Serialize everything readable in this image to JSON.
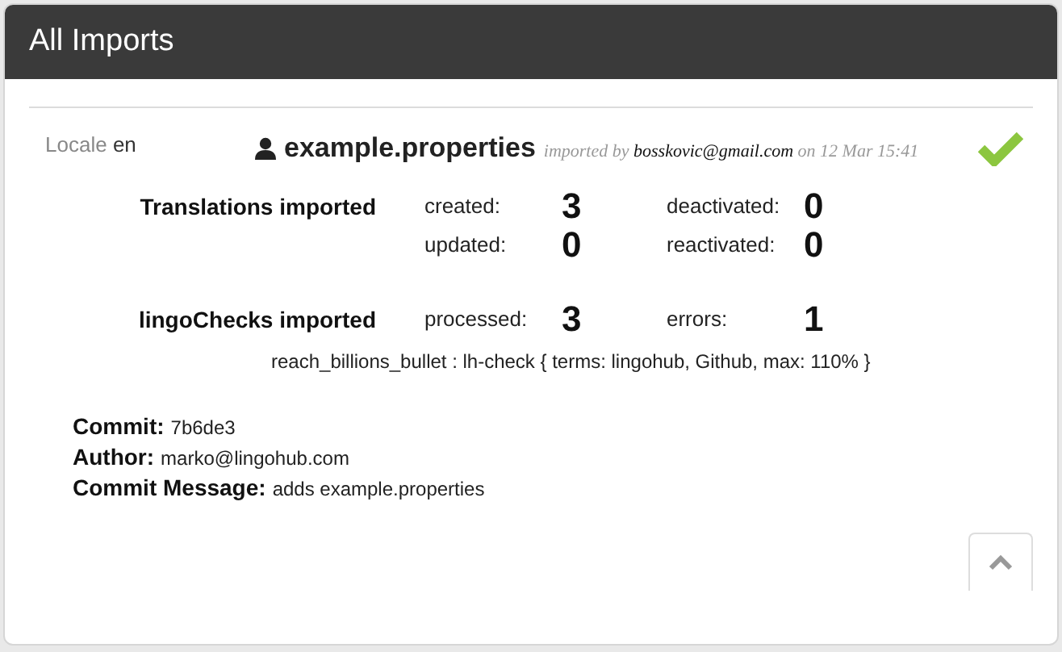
{
  "header": {
    "title": "All Imports"
  },
  "import": {
    "locale_label": "Locale",
    "locale": "en",
    "file": "example.properties",
    "imported_by": "imported by **bosskovic@gmail.com** on 12 Mar 15:41",
    "success": true,
    "sections": [
      {
        "title": "Translations imported",
        "stats": [
          {
            "label": "created:",
            "value": "3"
          },
          {
            "label": "deactivated:",
            "value": "0"
          },
          {
            "label": "updated:",
            "value": "0"
          },
          {
            "label": "reactivated:",
            "value": "0"
          }
        ]
      },
      {
        "title": "lingoChecks imported",
        "stats": [
          {
            "label": "processed:",
            "value": "3"
          },
          {
            "label": "errors:",
            "value": "1"
          }
        ],
        "errors": [
          "reach_billions_bullet : lh-check { terms: lingohub, Github, max: 110% }"
        ]
      }
    ],
    "commit": [
      {
        "label": "Commit:",
        "value": "7b6de3"
      },
      {
        "label": "Author:",
        "value": "marko@lingohub.com"
      },
      {
        "label": "Commit Message:",
        "value": "adds example.properties"
      }
    ]
  }
}
